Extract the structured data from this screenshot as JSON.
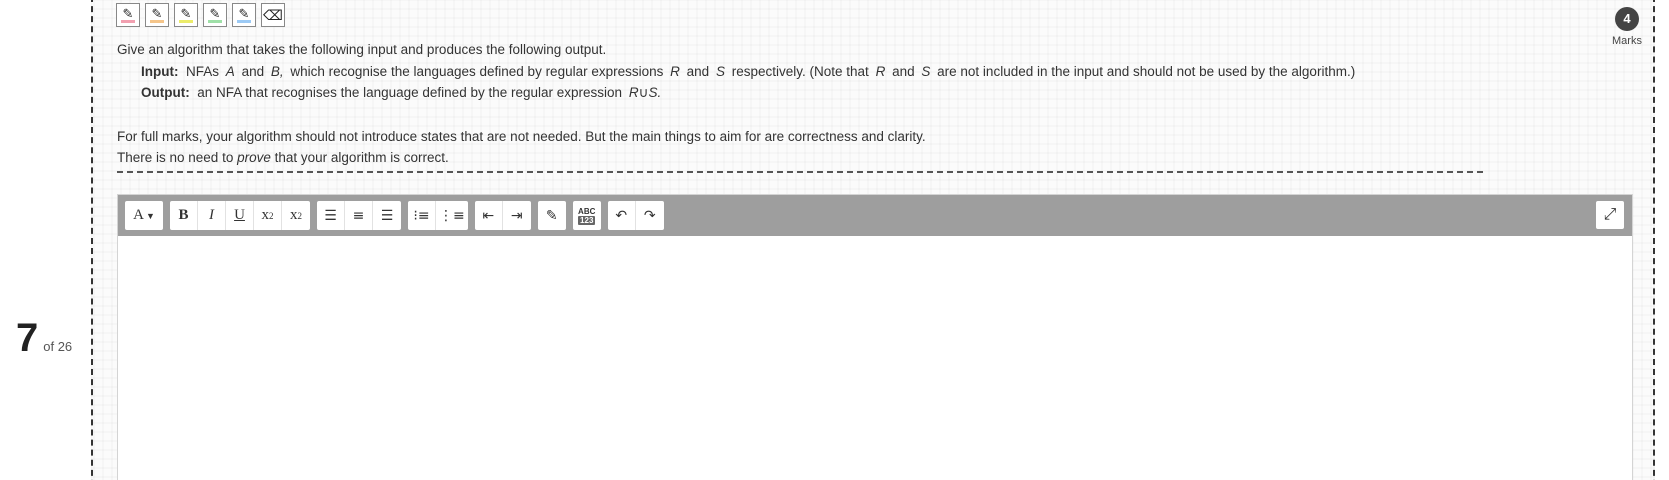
{
  "question_index": {
    "number": "7",
    "total_label": "of 26"
  },
  "highlighters": [
    {
      "name": "red-highlighter",
      "color": "#f2a0b0"
    },
    {
      "name": "orange-highlighter",
      "color": "#f5c58a"
    },
    {
      "name": "yellow-highlighter",
      "color": "#ecec6a"
    },
    {
      "name": "green-highlighter",
      "color": "#9fe0a8"
    },
    {
      "name": "blue-highlighter",
      "color": "#9ccaf5"
    }
  ],
  "eraser_icon": "eraser-icon",
  "marks": {
    "value": "4",
    "label": "Marks"
  },
  "question": {
    "intro": "Give an algorithm that takes the following input and produces the following output.",
    "input_label": "Input:",
    "input_text_1": "NFAs",
    "var_A": "A",
    "and_1": "and",
    "var_B": "B,",
    "input_text_2": "which recognise the languages defined by regular expressions",
    "var_R": "R",
    "and_2": "and",
    "var_S": "S",
    "input_text_3": "respectively.  (Note that",
    "var_R2": "R",
    "and_3": "and",
    "var_S2": "S",
    "input_text_4": "are not included in the input and should not be used by the algorithm.)",
    "output_label": "Output:",
    "output_text": "an NFA that recognises the language defined by the regular expression",
    "output_expr": "R∪S.",
    "full_marks": "For full marks, your algorithm should not introduce states that are not needed.  But the main things to aim for are correctness and clarity.",
    "no_need_1": "There is no need to",
    "no_need_em": "prove",
    "no_need_2": "that your algorithm is correct."
  },
  "toolbar": {
    "font": "A",
    "bold": "B",
    "italic": "I",
    "underline": "U",
    "subscript_base": "x",
    "subscript": "2",
    "superscript_base": "x",
    "superscript": "2",
    "spellcheck_top": "ABC",
    "spellcheck_bottom": "123"
  },
  "editor": {
    "content": ""
  }
}
